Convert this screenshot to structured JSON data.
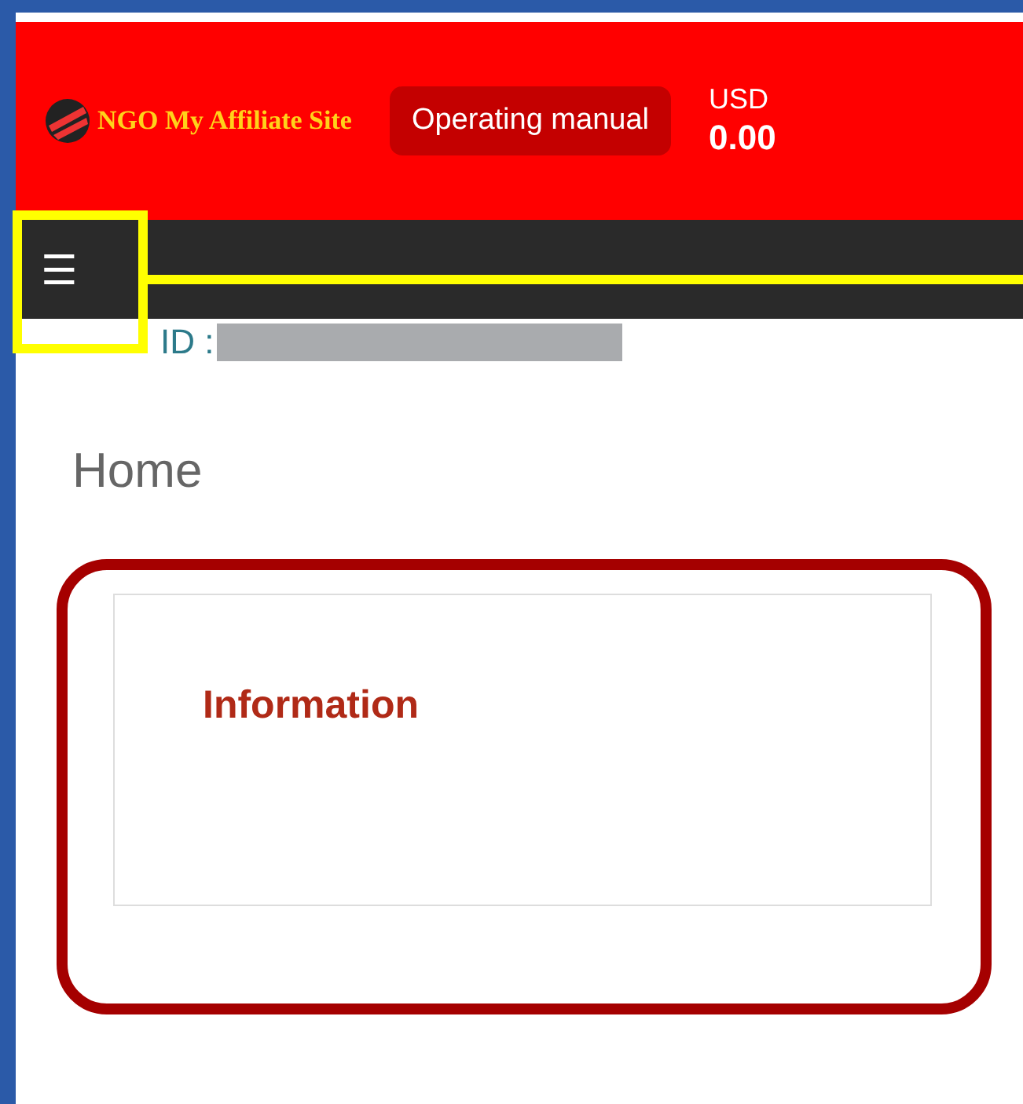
{
  "header": {
    "logo_text": "NGO My Affiliate Site",
    "manual_button": "Operating manual",
    "currency": "USD",
    "balance": "0.00"
  },
  "navbar": {
    "menu_button": "☰"
  },
  "account": {
    "id_label": "ID :",
    "redacted": true
  },
  "page_title": "Home",
  "info_card": {
    "title": "Information"
  },
  "annotations": [
    {
      "kind": "highlight-box"
    },
    {
      "kind": "highlight-line"
    },
    {
      "kind": "callout-frame"
    }
  ]
}
